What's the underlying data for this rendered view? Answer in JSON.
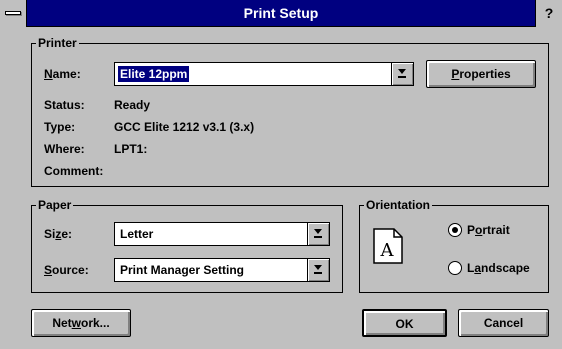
{
  "window": {
    "title": "Print Setup",
    "help": "?"
  },
  "printer": {
    "group_label": "Printer",
    "name_label": "Name:",
    "name_accel": "N",
    "name_rest": "ame:",
    "name_value": "Elite 12ppm",
    "properties_accel": "P",
    "properties_rest": "roperties",
    "status_label": "Status:",
    "status_value": "Ready",
    "type_label": "Type:",
    "type_value": "GCC Elite 1212 v3.1 (3.x)",
    "where_label": "Where:",
    "where_value": "LPT1:",
    "comment_label": "Comment:"
  },
  "paper": {
    "group_label": "Paper",
    "size_pre": "Si",
    "size_accel": "z",
    "size_post": "e:",
    "size_value": "Letter",
    "source_accel": "S",
    "source_rest": "ource:",
    "source_value": "Print Manager Setting"
  },
  "orientation": {
    "group_label": "Orientation",
    "page_glyph": "A",
    "portrait_pre": "P",
    "portrait_accel": "o",
    "portrait_post": "rtrait",
    "landscape_pre": "L",
    "landscape_accel": "a",
    "landscape_post": "ndscape",
    "selected": "portrait"
  },
  "buttons": {
    "network_pre": "Net",
    "network_accel": "w",
    "network_post": "ork...",
    "ok": "OK",
    "cancel": "Cancel"
  },
  "colors": {
    "title_bar": "#000080",
    "face": "#c0c0c0",
    "selection": "#000080"
  }
}
